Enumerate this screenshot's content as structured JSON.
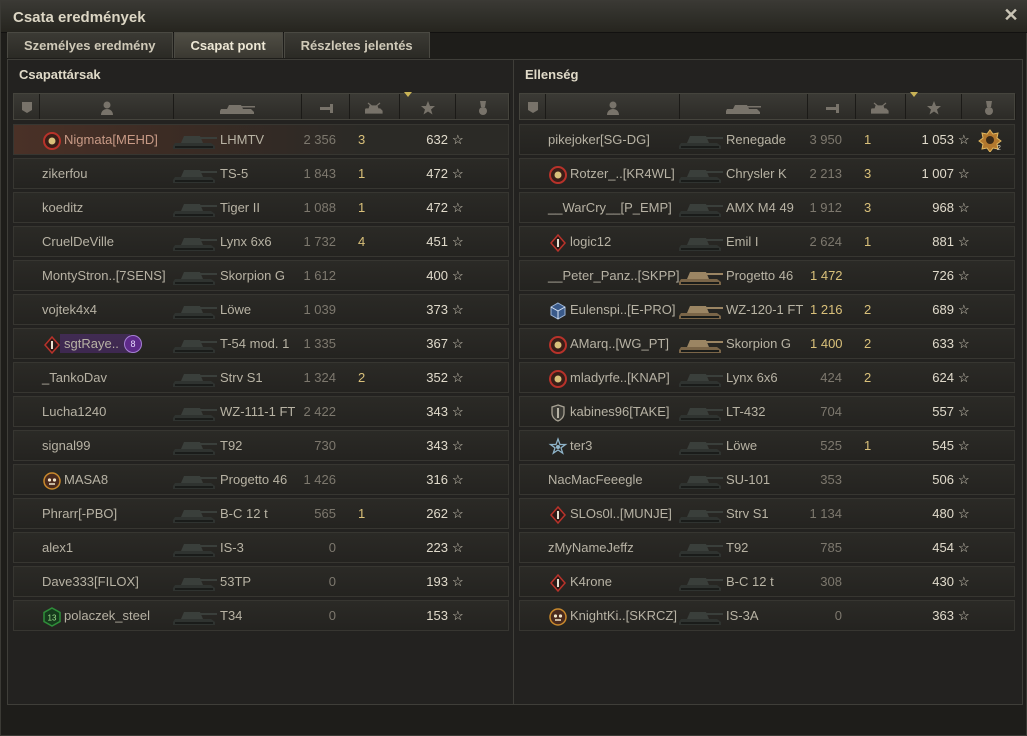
{
  "window": {
    "title": "Csata eredmények"
  },
  "tabs": [
    {
      "label": "Személyes eredmény",
      "active": false
    },
    {
      "label": "Csapat pont",
      "active": true
    },
    {
      "label": "Részletes jelentés",
      "active": false
    }
  ],
  "allies": {
    "title": "Csapattársak",
    "rows": [
      {
        "name": "Nigmata[MEHD]",
        "vehicle": "LHMTV",
        "damage": "2 356",
        "kills": "3",
        "xp": "632",
        "badge": "red",
        "self": true
      },
      {
        "name": "zikerfou",
        "vehicle": "TS-5",
        "damage": "1 843",
        "kills": "1",
        "xp": "472",
        "badge": ""
      },
      {
        "name": "koeditz",
        "vehicle": "Tiger II",
        "damage": "1 088",
        "kills": "1",
        "xp": "472",
        "badge": ""
      },
      {
        "name": "CruelDeVille",
        "vehicle": "Lynx 6x6",
        "damage": "1 732",
        "kills": "4",
        "xp": "451",
        "badge": ""
      },
      {
        "name": "MontyStron..[7SENS]",
        "vehicle": "Skorpion G",
        "damage": "1 612",
        "kills": "",
        "xp": "400",
        "badge": ""
      },
      {
        "name": "vojtek4x4",
        "vehicle": "Löwe",
        "damage": "1 039",
        "kills": "",
        "xp": "373",
        "badge": ""
      },
      {
        "name": "sgtRaye..",
        "vehicle": "T-54 mod. 1",
        "damage": "1 335",
        "kills": "",
        "xp": "367",
        "badge": "diamond",
        "extra": "8"
      },
      {
        "name": "_TankoDav",
        "vehicle": "Strv S1",
        "damage": "1 324",
        "kills": "2",
        "xp": "352",
        "badge": ""
      },
      {
        "name": "Lucha1240",
        "vehicle": "WZ-111-1 FT",
        "damage": "2 422",
        "kills": "",
        "xp": "343",
        "badge": ""
      },
      {
        "name": "signal99",
        "vehicle": "T92",
        "damage": "730",
        "kills": "",
        "xp": "343",
        "badge": ""
      },
      {
        "name": "MASA8",
        "vehicle": "Progetto 46",
        "damage": "1 426",
        "kills": "",
        "xp": "316",
        "badge": "skull"
      },
      {
        "name": "Phrarr[-PBO]",
        "vehicle": "B-C 12 t",
        "damage": "565",
        "kills": "1",
        "xp": "262",
        "badge": ""
      },
      {
        "name": "alex1",
        "vehicle": "IS-3",
        "damage": "0",
        "kills": "",
        "xp": "223",
        "badge": ""
      },
      {
        "name": "Dave333[FILOX]",
        "vehicle": "53TP",
        "damage": "0",
        "kills": "",
        "xp": "193",
        "badge": ""
      },
      {
        "name": "polaczek_steel",
        "vehicle": "T34",
        "damage": "0",
        "kills": "",
        "xp": "153",
        "badge": "green",
        "badge_text": "13"
      }
    ]
  },
  "enemies": {
    "title": "Ellenség",
    "rows": [
      {
        "name": "pikejoker[SG-DG]",
        "vehicle": "Renegade",
        "damage": "3 950",
        "kills": "1",
        "xp": "1 053",
        "badge": "",
        "medal": "2"
      },
      {
        "name": "Rotzer_..[KR4WL]",
        "vehicle": "Chrysler K",
        "damage": "2 213",
        "kills": "3",
        "xp": "1 007",
        "badge": "red"
      },
      {
        "name": "__WarCry__[P_EMP]",
        "vehicle": "AMX M4 49",
        "damage": "1 912",
        "kills": "3",
        "xp": "968",
        "badge": ""
      },
      {
        "name": "logic12",
        "vehicle": "Emil I",
        "damage": "2 624",
        "kills": "1",
        "xp": "881",
        "badge": "diamond"
      },
      {
        "name": "__Peter_Panz..[SKPP]",
        "vehicle": "Progetto 46",
        "damage": "1 472",
        "kills": "",
        "xp": "726",
        "badge": "",
        "dmg_hi": true,
        "camo": true
      },
      {
        "name": "Eulenspi..[E-PRO]",
        "vehicle": "WZ-120-1 FT",
        "damage": "1 216",
        "kills": "2",
        "xp": "689",
        "badge": "cube",
        "dmg_hi": true,
        "camo": true
      },
      {
        "name": "AMarq..[WG_PT]",
        "vehicle": "Skorpion G",
        "damage": "1 400",
        "kills": "2",
        "xp": "633",
        "badge": "red",
        "dmg_hi": true,
        "camo": true
      },
      {
        "name": "mladyrfe..[KNAP]",
        "vehicle": "Lynx 6x6",
        "damage": "424",
        "kills": "2",
        "xp": "624",
        "badge": "red"
      },
      {
        "name": "kabines96[TAKE]",
        "vehicle": "LT-432",
        "damage": "704",
        "kills": "",
        "xp": "557",
        "badge": "shield"
      },
      {
        "name": "ter3",
        "vehicle": "Löwe",
        "damage": "525",
        "kills": "1",
        "xp": "545",
        "badge": "star"
      },
      {
        "name": "NacMacFeeegle",
        "vehicle": "SU-101",
        "damage": "353",
        "kills": "",
        "xp": "506",
        "badge": ""
      },
      {
        "name": "SLOs0l..[MUNJE]",
        "vehicle": "Strv S1",
        "damage": "1 134",
        "kills": "",
        "xp": "480",
        "badge": "diamond"
      },
      {
        "name": "zMyNameJeffz",
        "vehicle": "T92",
        "damage": "785",
        "kills": "",
        "xp": "454",
        "badge": ""
      },
      {
        "name": "K4rone",
        "vehicle": "B-C 12 t",
        "damage": "308",
        "kills": "",
        "xp": "430",
        "badge": "diamond"
      },
      {
        "name": "KnightKi..[SKRCZ]",
        "vehicle": "IS-3A",
        "damage": "0",
        "kills": "",
        "xp": "363",
        "badge": "skull"
      }
    ]
  },
  "colors": {
    "accent": "#d9c07a",
    "self_row": "#4a3127",
    "badge_red": "#b8322a",
    "badge_green": "#2f8f3a"
  }
}
